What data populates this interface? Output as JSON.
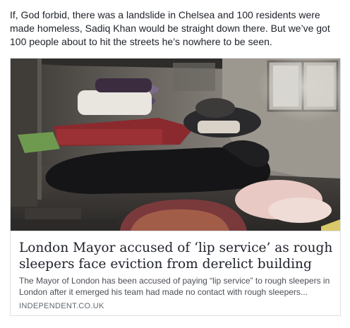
{
  "post": {
    "text": "If, God forbid, there was a landslide in Chelsea and 100 residents were made homeless, Sadiq Khan would be straight down there. But we’ve got 100 people about to hit the streets he’s nowhere to be seen."
  },
  "link_card": {
    "image_icon": "photo-of-rough-sleepers-in-derelict-building",
    "title": "London Mayor accused of ‘lip service’ as rough sleepers face eviction from derelict building",
    "description": "The Mayor of London has been accused of paying “lip service” to rough sleepers in London after it emerged his team had made no contact with rough sleepers...",
    "source": "INDEPENDENT.CO.UK"
  },
  "colors": {
    "text": "#1d2129",
    "secondary_text": "#606770",
    "border": "#dddfe2"
  }
}
